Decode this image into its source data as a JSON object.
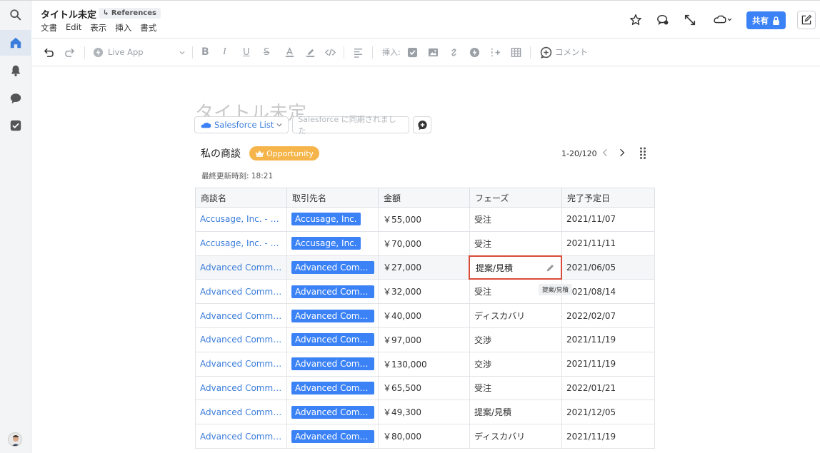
{
  "header": {
    "title": "タイトル未定",
    "ref_chip": "↳ References",
    "menu": [
      "文書",
      "Edit",
      "表示",
      "挿入",
      "書式"
    ],
    "share_label": "共有"
  },
  "toolbar": {
    "live_app": "Live App",
    "insert_label": "挿入:",
    "comment_label": "コメント"
  },
  "document": {
    "title": "タイトル未定",
    "sf_list_label": "Salesforce List",
    "sync_placeholder": "Salesforce に同期されました"
  },
  "list": {
    "title": "私の商談",
    "badge": "Opportunity",
    "pager": "1-20/120",
    "updated": "最終更新時刻: 18:21",
    "columns": [
      "商談名",
      "取引先名",
      "金額",
      "フェーズ",
      "完了予定日"
    ],
    "rows": [
      {
        "name": "Accusage, Inc. - Serv...",
        "account": "Accusage, Inc.",
        "amount": "￥55,000",
        "phase": "受注",
        "date": "2021/11/07"
      },
      {
        "name": "Accusage, Inc. - Serv...",
        "account": "Accusage, Inc.",
        "amount": "￥70,000",
        "phase": "受注",
        "date": "2021/11/11"
      },
      {
        "name": "Advanced Commun...",
        "account": "Advanced Commu...",
        "amount": "￥27,000",
        "phase": "提案/見積",
        "date": "2021/06/05"
      },
      {
        "name": "Advanced Commun...",
        "account": "Advanced Commu...",
        "amount": "￥32,000",
        "phase": "受注",
        "date": "2021/08/14"
      },
      {
        "name": "Advanced Commun...",
        "account": "Advanced Commu...",
        "amount": "￥40,000",
        "phase": "ディスカバリ",
        "date": "2022/02/07"
      },
      {
        "name": "Advanced Commun...",
        "account": "Advanced Commu...",
        "amount": "￥97,000",
        "phase": "交渉",
        "date": "2021/11/19"
      },
      {
        "name": "Advanced Commun...",
        "account": "Advanced Commu...",
        "amount": "￥130,000",
        "phase": "交渉",
        "date": "2021/11/19"
      },
      {
        "name": "Advanced Commun...",
        "account": "Advanced Commu...",
        "amount": "￥65,500",
        "phase": "受注",
        "date": "2022/01/21"
      },
      {
        "name": "Advanced Commun...",
        "account": "Advanced Commu...",
        "amount": "￥49,300",
        "phase": "提案/見積",
        "date": "2021/12/05"
      },
      {
        "name": "Advanced Commun...",
        "account": "Advanced Commu...",
        "amount": "￥80,000",
        "phase": "ディスカバリ",
        "date": "2021/11/19"
      }
    ],
    "editing_phase": "提案/見積",
    "tooltip": "提案/見積"
  },
  "colors": {
    "accent": "#3b82f6",
    "badge": "#f5b54a",
    "edit_border": "#d94a38"
  }
}
